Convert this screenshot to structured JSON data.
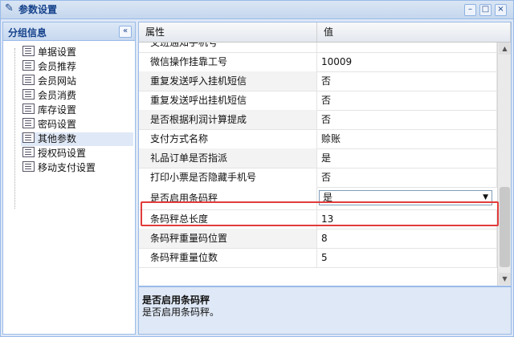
{
  "window": {
    "title": "参数设置"
  },
  "sidebar": {
    "title": "分组信息",
    "collapse_glyph": "«",
    "items": [
      {
        "label": "单据设置"
      },
      {
        "label": "会员推荐"
      },
      {
        "label": "会员网站"
      },
      {
        "label": "会员消费"
      },
      {
        "label": "库存设置"
      },
      {
        "label": "密码设置"
      },
      {
        "label": "其他参数"
      },
      {
        "label": "授权码设置"
      },
      {
        "label": "移动支付设置"
      }
    ],
    "selected": "其他参数"
  },
  "grid": {
    "columns": [
      "属性",
      "值"
    ],
    "rows": [
      {
        "name": "交班通知手机号",
        "value": ""
      },
      {
        "name": "微信操作挂靠工号",
        "value": "10009"
      },
      {
        "name": "重复发送呼入挂机短信",
        "value": "否"
      },
      {
        "name": "重复发送呼出挂机短信",
        "value": "否"
      },
      {
        "name": "是否根据利润计算提成",
        "value": "否"
      },
      {
        "name": "支付方式名称",
        "value": "赊账"
      },
      {
        "name": "礼品订单是否指派",
        "value": "是"
      },
      {
        "name": "打印小票是否隐藏手机号",
        "value": "否"
      },
      {
        "name": "是否启用条码秤",
        "value": "是"
      },
      {
        "name": "条码秤总长度",
        "value": "13"
      },
      {
        "name": "条码秤重量码位置",
        "value": "8"
      },
      {
        "name": "条码秤重量位数",
        "value": "5"
      }
    ],
    "selected_row": "是否启用条码秤"
  },
  "description": {
    "title": "是否启用条码秤",
    "text": "是否启用条码秤。"
  },
  "colors": {
    "highlight": "#e23b3b",
    "panel_border": "#99bbe8",
    "title_text": "#15428b"
  }
}
